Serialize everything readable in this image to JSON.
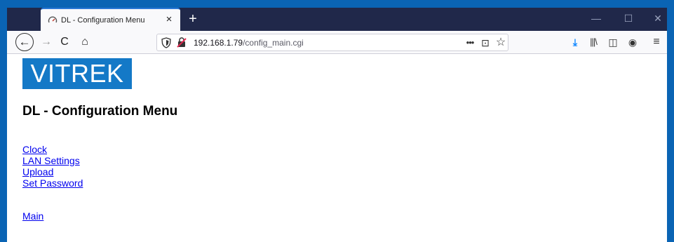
{
  "browser": {
    "tab": {
      "title": "DL - Configuration Menu",
      "close_glyph": "×",
      "favicon": "gauge-icon"
    },
    "new_tab_glyph": "+",
    "window_controls": {
      "minimize": "—",
      "maximize": "☐",
      "close": "✕"
    },
    "nav": {
      "back": "←",
      "forward": "→",
      "reload": "C",
      "home": "⌂"
    },
    "url": {
      "host": "192.168.1.79",
      "path": "/config_main.cgi"
    },
    "url_actions": {
      "more": "•••",
      "pocket": "⊡",
      "star": "☆"
    },
    "toolbar": {
      "download": "⤓",
      "library": "|||\\",
      "sidebar": "◫",
      "account": "◉",
      "menu": "≡"
    },
    "accent": "#2a78d6"
  },
  "page": {
    "logo_text": "VITREK",
    "title": "DL - Configuration Menu",
    "links": [
      "Clock",
      "LAN Settings",
      "Upload",
      "Set Password"
    ],
    "main_link": "Main",
    "link_color": "#0000ee",
    "brand_color": "#1479c7"
  }
}
